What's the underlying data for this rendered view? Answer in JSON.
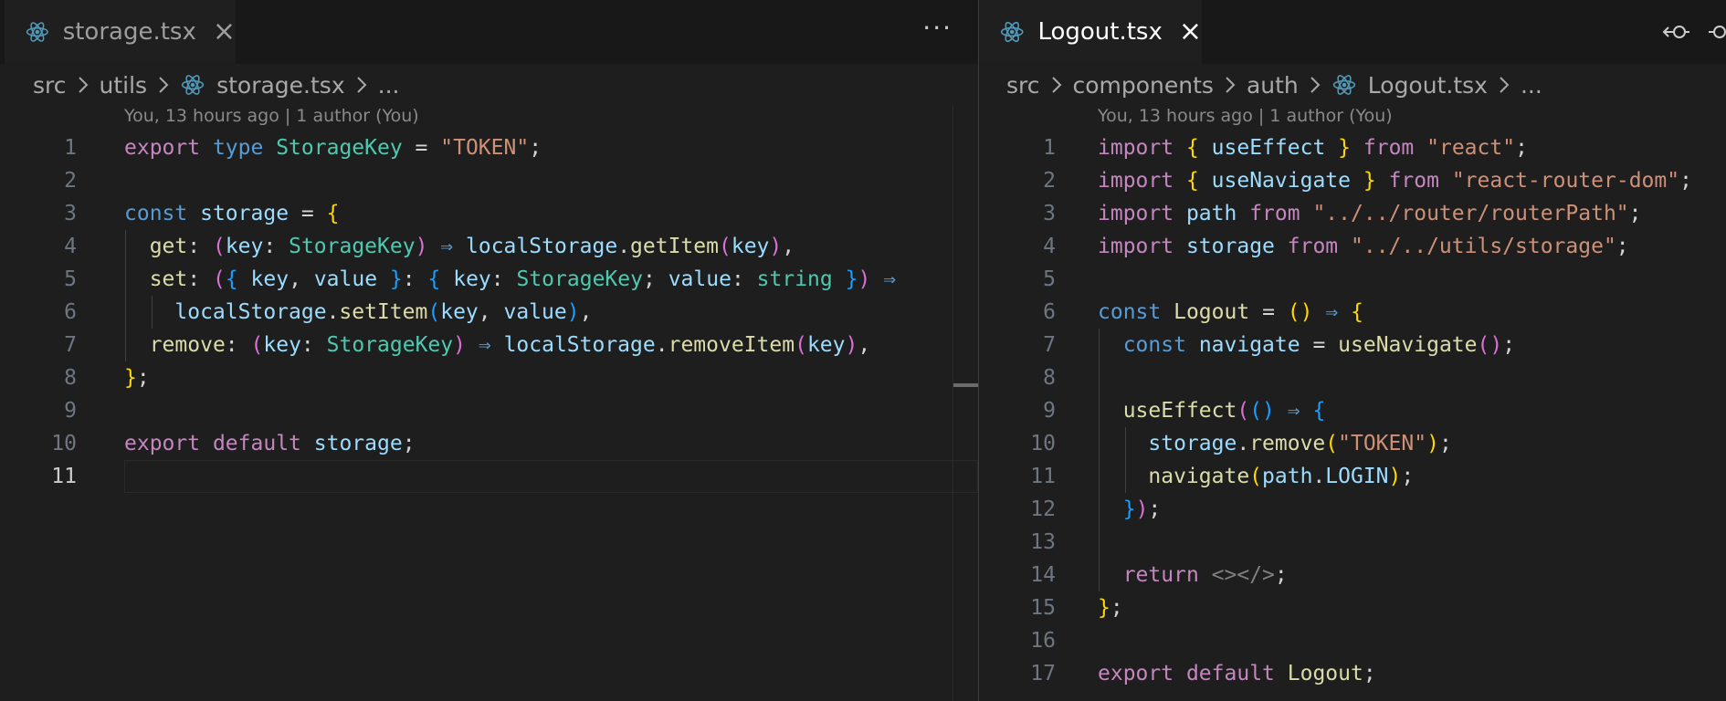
{
  "left": {
    "tab": {
      "title": "storage.tsx",
      "close": "×"
    },
    "more": "···",
    "breadcrumb": [
      "src",
      "utils",
      "storage.tsx",
      "..."
    ],
    "blame": "You, 13 hours ago | 1 author (You)",
    "line_numbers": [
      "1",
      "2",
      "3",
      "4",
      "5",
      "6",
      "7",
      "8",
      "9",
      "10",
      "11"
    ],
    "active_line": "11"
  },
  "right": {
    "tab": {
      "title": "Logout.tsx",
      "close": "×"
    },
    "breadcrumb": [
      "src",
      "components",
      "auth",
      "Logout.tsx",
      "..."
    ],
    "blame": "You, 13 hours ago | 1 author (You)",
    "line_numbers": [
      "1",
      "2",
      "3",
      "4",
      "5",
      "6",
      "7",
      "8",
      "9",
      "10",
      "11",
      "12",
      "13",
      "14",
      "15",
      "16",
      "17"
    ]
  },
  "colors": {
    "background": "#1e1e1e",
    "keyword": "#c586c0",
    "type": "#4ec9b0",
    "string": "#ce9178",
    "variable": "#9cdcfe",
    "function": "#dcdcaa",
    "react_icon": "#519aba"
  },
  "icons": [
    "react-icon",
    "close-icon",
    "more-icon",
    "chevron-right-icon",
    "compare-icon"
  ]
}
